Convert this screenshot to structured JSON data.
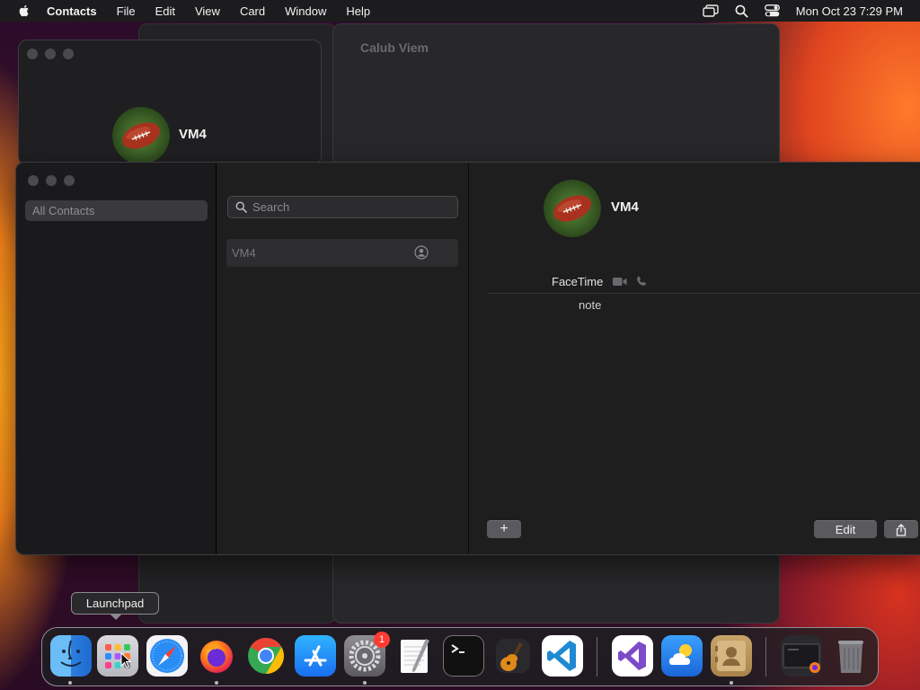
{
  "menubar": {
    "app_name": "Contacts",
    "items": [
      "File",
      "Edit",
      "View",
      "Card",
      "Window",
      "Help"
    ],
    "clock": "Mon Oct 23  7:29 PM"
  },
  "background_window": {
    "title": "Calub Viem"
  },
  "small_window": {
    "contact_name": "VM4"
  },
  "sidebar": {
    "group_label": "All Contacts"
  },
  "list": {
    "search_placeholder": "Search",
    "contacts": [
      {
        "name": "VM4"
      }
    ]
  },
  "detail": {
    "name": "VM4",
    "facetime_label": "FaceTime",
    "note_label": "note",
    "add_label": "+",
    "edit_label": "Edit"
  },
  "tooltip": {
    "text": "Launchpad"
  },
  "dock": {
    "apps": [
      {
        "name": "Finder",
        "icon": "finder-icon",
        "running": true
      },
      {
        "name": "Launchpad",
        "icon": "launchpad-icon",
        "running": false
      },
      {
        "name": "Safari",
        "icon": "safari-icon",
        "running": false
      },
      {
        "name": "Firefox",
        "icon": "firefox-icon",
        "running": true
      },
      {
        "name": "Chrome",
        "icon": "chrome-icon",
        "running": false
      },
      {
        "name": "App Store",
        "icon": "app-store-icon",
        "running": false
      },
      {
        "name": "System Settings",
        "icon": "system-settings-icon",
        "running": true,
        "badge": "1"
      },
      {
        "name": "TextEdit",
        "icon": "textedit-icon",
        "running": false
      },
      {
        "name": "Terminal",
        "icon": "terminal-icon",
        "running": false
      },
      {
        "name": "GarageBand",
        "icon": "garageband-icon",
        "running": false
      },
      {
        "name": "Visual Studio Code",
        "icon": "vscode-icon",
        "running": false
      },
      {
        "name": "Visual Studio",
        "icon": "visual-studio-icon",
        "running": false
      },
      {
        "name": "Weather",
        "icon": "weather-icon",
        "running": false
      },
      {
        "name": "Contacts",
        "icon": "contacts-icon",
        "running": true
      },
      {
        "name": "Downloads",
        "icon": "downloads-folder-icon",
        "running": false
      },
      {
        "name": "Trash",
        "icon": "trash-icon",
        "running": false
      }
    ]
  }
}
